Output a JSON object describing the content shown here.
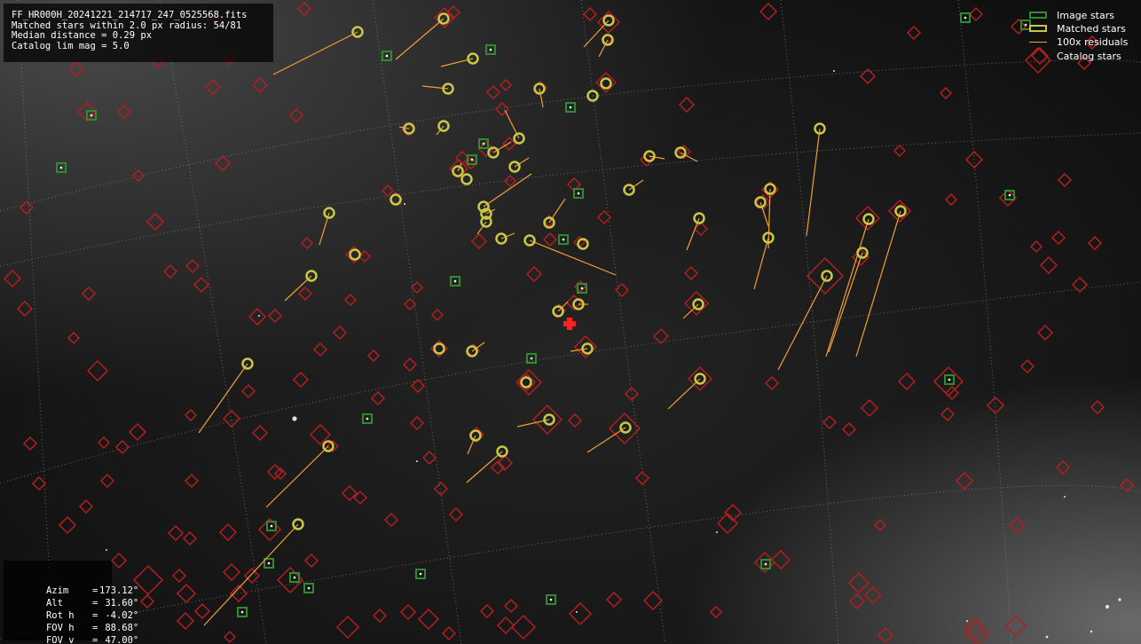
{
  "header": {
    "filename": "FF_HR000H_20241221_214717_247_0525568.fits",
    "matched_line": "Matched stars within 2.0 px radius: 54/81",
    "median_line": "Median distance = 0.29 px",
    "limmag_line": "Catalog lim mag = 5.0"
  },
  "legend": {
    "image_stars": "Image stars",
    "matched_stars": "Matched stars",
    "residuals": "100x residuals",
    "catalog_stars": "Catalog stars"
  },
  "pointing": {
    "azim_label": "Azim",
    "azim_eq": "=",
    "azim_value": "173.12°",
    "alt_label": "Alt",
    "alt_eq": "=",
    "alt_value": "31.60°",
    "rot_label": "Rot h",
    "rot_eq": "=",
    "rot_value": "-4.02°",
    "fovh_label": "FOV h",
    "fovh_eq": "=",
    "fovh_value": "88.68°",
    "fovv_label": "FOV v",
    "fovv_eq": "=",
    "fovv_value": "47.00°"
  },
  "colors": {
    "image_star": "#2e8b2e",
    "matched_star": "#c8c846",
    "residual": "#f0a030",
    "catalog_star": "#b41e1e",
    "center_marker": "#ff2020",
    "grid": "#8a8a8a"
  }
}
